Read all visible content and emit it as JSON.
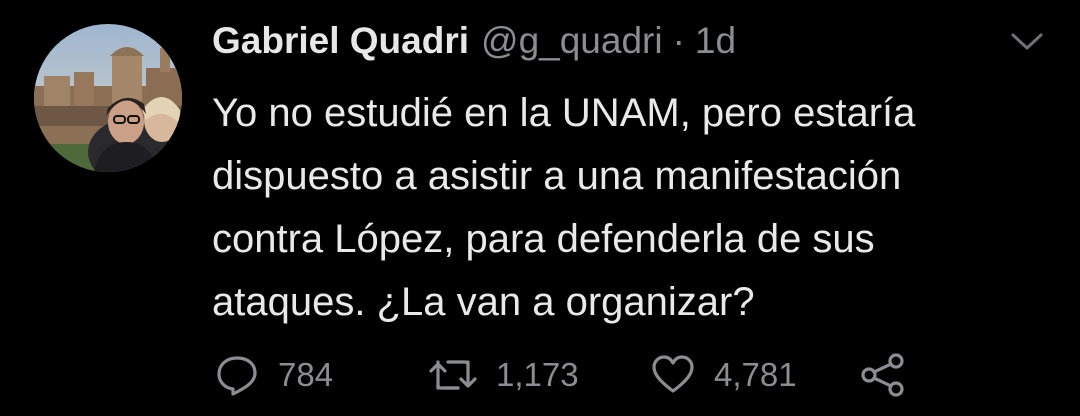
{
  "tweet": {
    "author": {
      "display_name": "Gabriel Quadri",
      "handle": "@g_quadri",
      "separator": "·",
      "time": "1d",
      "avatar_icon": "profile-photo"
    },
    "text_lines": [
      "Yo no estudié en la UNAM, pero estaría",
      "dispuesto a asistir a una manifestación",
      "contra López, para defenderla de sus",
      "ataques. ¿La van a organizar?"
    ],
    "actions": {
      "reply": {
        "icon": "reply-icon",
        "count": "784"
      },
      "retweet": {
        "icon": "retweet-icon",
        "count": "1,173"
      },
      "like": {
        "icon": "heart-icon",
        "count": "4,781"
      },
      "share": {
        "icon": "share-icon"
      }
    },
    "menu_icon": "chevron-down-icon"
  },
  "colors": {
    "background": "#000000",
    "text": "#e9e9e9",
    "secondary": "#8a8d91"
  }
}
